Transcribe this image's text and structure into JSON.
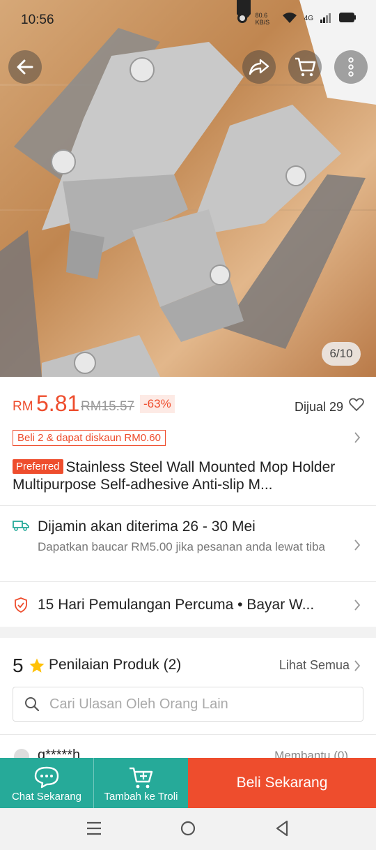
{
  "status": {
    "time": "10:56",
    "speed": "80.6 KB/S",
    "network": "4G"
  },
  "hero": {
    "counter": "6/10"
  },
  "product": {
    "currency": "RM",
    "price": "5.81",
    "original_price": "RM15.57",
    "discount": "-63%",
    "sold": "Dijual 29",
    "promo": "Beli 2 & dapat diskaun RM0.60",
    "badge": "Preferred",
    "title": "Stainless Steel Wall Mounted Mop Holder Multipurpose Self-adhesive Anti-slip M..."
  },
  "shipping": {
    "title": "Dijamin akan diterima 26 - 30 Mei",
    "subtitle": "Dapatkan baucar RM5.00 jika pesanan anda lewat tiba"
  },
  "returns": {
    "text": "15 Hari Pemulangan Percuma  •  Bayar W..."
  },
  "rating": {
    "score": "5",
    "title": "Penilaian Produk (2)",
    "see_all": "Lihat Semua",
    "search_placeholder": "Cari Ulasan Oleh Orang Lain"
  },
  "review_peek": {
    "name": "g*****h",
    "helpful": "Membantu (0)"
  },
  "bottom": {
    "chat": "Chat Sekarang",
    "cart": "Tambah ke Troli",
    "buy": "Beli Sekarang"
  },
  "colors": {
    "brand": "#ee4d2d",
    "teal": "#26aa99"
  }
}
